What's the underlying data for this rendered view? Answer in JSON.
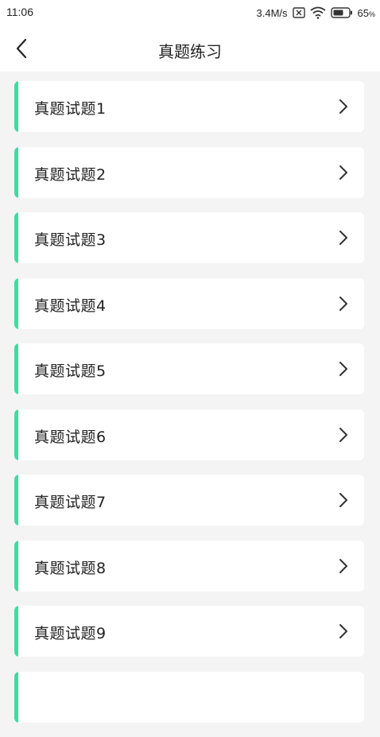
{
  "status_bar": {
    "time": "11:06",
    "network_speed": "3.4M/s",
    "sim_icon": "sim-x-icon",
    "wifi_icon": "wifi-icon",
    "battery_icon": "battery-icon",
    "battery_percent": "65",
    "battery_unit": "%"
  },
  "nav": {
    "back_icon": "chevron-left-icon",
    "title": "真题练习"
  },
  "colors": {
    "accent": "#3fdba0",
    "background": "#f4f4f4",
    "card": "#ffffff",
    "text": "#222222",
    "chevron": "#333333"
  },
  "list": {
    "chevron_icon": "chevron-right-icon",
    "items": [
      {
        "label": "真题试题1"
      },
      {
        "label": "真题试题2"
      },
      {
        "label": "真题试题3"
      },
      {
        "label": "真题试题4"
      },
      {
        "label": "真题试题5"
      },
      {
        "label": "真题试题6"
      },
      {
        "label": "真题试题7"
      },
      {
        "label": "真题试题8"
      },
      {
        "label": "真题试题9"
      },
      {
        "label": ""
      }
    ]
  }
}
